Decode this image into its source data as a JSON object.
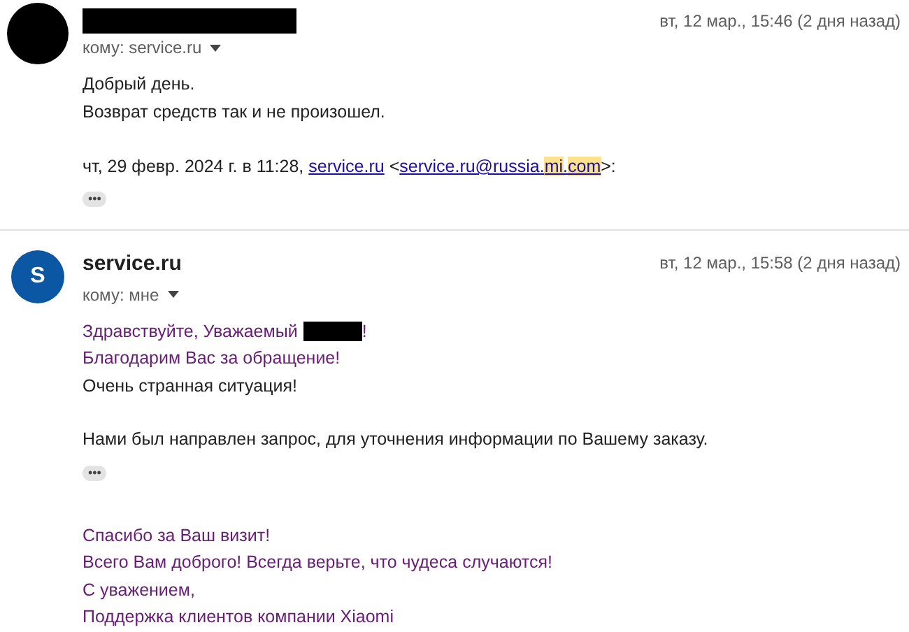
{
  "messages": [
    {
      "avatar": {
        "kind": "redacted"
      },
      "sender": {
        "redacted": true
      },
      "date": "вт, 12 мар., 15:46 (2 дня назад)",
      "recipient": "кому: service.ru",
      "paragraphs": [
        {
          "lines": [
            {
              "text": "Добрый день.",
              "color": "#222222"
            },
            {
              "text": "Возврат средств так и не произошел.",
              "color": "#222222"
            }
          ]
        }
      ],
      "quote": [
        {
          "kind": "text",
          "text": "чт, 29 февр. 2024 г. в 11:28,"
        },
        {
          "kind": "link",
          "text": "service.ru"
        },
        {
          "kind": "text",
          "text": "<"
        },
        {
          "kind": "link",
          "parts": [
            {
              "text": "service.ru@russia.",
              "highlight": false
            },
            {
              "text": "mi",
              "highlight": true
            },
            {
              "text": ".",
              "highlight": false
            },
            {
              "text": "com",
              "highlight": true
            }
          ]
        },
        {
          "kind": "text",
          "text": ">:"
        }
      ],
      "more": "•••"
    },
    {
      "avatar": {
        "kind": "letter",
        "letter": "S"
      },
      "sender": {
        "redacted": false,
        "name": "service.ru"
      },
      "date": "вт, 12 мар., 15:58 (2 дня назад)",
      "recipient": "кому: мне",
      "paragraphs": [
        {
          "lines": [
            {
              "text": "Здравствуйте, Уважаемый",
              "color": "#6a1b7a",
              "redaction_after": true,
              "tail": "!"
            },
            {
              "text": "Благодарим Вас за обращение!",
              "color": "#6a1b7a"
            },
            {
              "text": "Очень странная ситуация!",
              "color": "#222222"
            }
          ]
        },
        {
          "lines": [
            {
              "text": "Нами был направлен запрос, для уточнения информации по Вашему заказу.",
              "color": "#222222"
            }
          ]
        }
      ],
      "more": "•••",
      "trailing": [
        {
          "lines": [
            {
              "text": "Спасибо за Ваш визит!",
              "color": "#6a1b7a"
            },
            {
              "text": "Всего Вам доброго! Всегда верьте, что чудеса случаются!",
              "color": "#6a1b7a"
            },
            {
              "text": "С уважением,",
              "color": "#6a1b7a"
            },
            {
              "text": "Поддержка клиентов компании Xiaomi",
              "color": "#6a1b7a"
            }
          ]
        }
      ]
    }
  ]
}
